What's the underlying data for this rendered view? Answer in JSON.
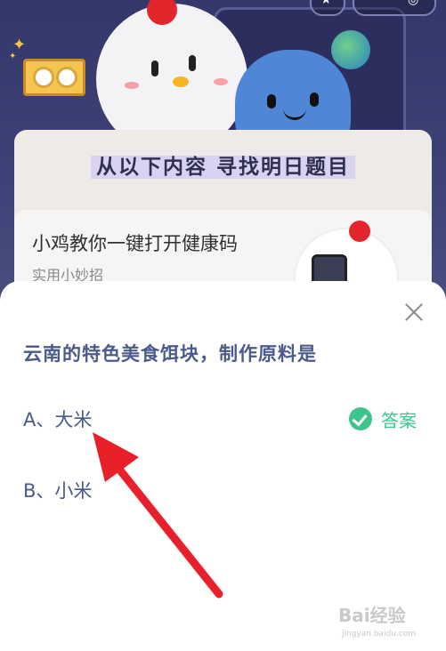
{
  "background_card": {
    "heading": "从以下内容 寻找明日题目",
    "item_title": "小鸡教你一键打开健康码",
    "item_subtitle": "实用小妙招"
  },
  "quiz": {
    "question": "云南的特色美食饵块，制作原料是",
    "options": [
      {
        "label": "A、大米",
        "is_answer": true
      },
      {
        "label": "B、小米",
        "is_answer": false
      }
    ],
    "answer_tag": "答案",
    "answer_icon": "check-circle-icon",
    "close_icon": "close-icon",
    "accent_color": "#3cc48a",
    "text_color": "#4a5a8a"
  },
  "annotation": {
    "arrow_color": "#e8202a",
    "points_to": "A、大米"
  },
  "watermark": {
    "text": "Bai经验",
    "sub": "jingyan.baidu.com"
  }
}
